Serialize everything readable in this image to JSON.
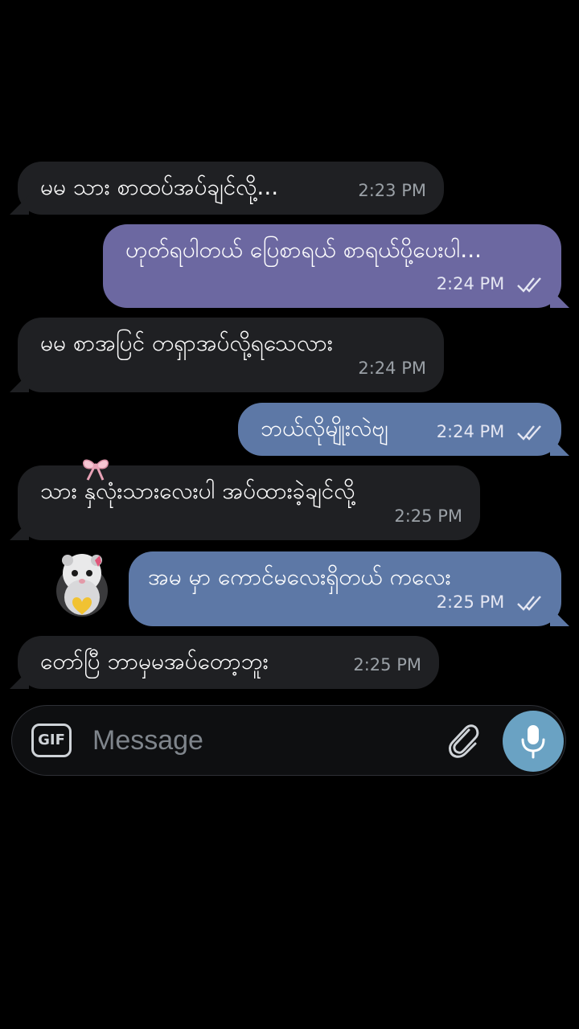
{
  "messages": [
    {
      "direction": "incoming",
      "text": "မမ သား စာထပ်အပ်ချင်လို့...",
      "time": "2:23 PM"
    },
    {
      "direction": "outgoing",
      "text": "ဟုတ်ရပါတယ် ပြေစာရယ် စာရယ်ပို့ပေးပါ...",
      "time": "2:24 PM",
      "read": true
    },
    {
      "direction": "incoming",
      "text": "မမ စာအပြင် တရှာအပ်လို့ရသေလား",
      "time": "2:24 PM"
    },
    {
      "direction": "outgoing",
      "text": "ဘယ်လိုမျိုးလဲဗျ",
      "time": "2:24 PM",
      "read": true
    },
    {
      "direction": "incoming",
      "text": "သား နှလုံးသားလေးပါ အပ်ထားခဲ့ချင်လို့",
      "time": "2:25 PM"
    },
    {
      "direction": "outgoing",
      "text": "အမ မှာ ကောင်မလေးရှိတယ် ကလေး",
      "time": "2:25 PM",
      "read": true
    },
    {
      "direction": "incoming",
      "text": "တော်ပြီ ဘာမှမအပ်တော့ဘူး",
      "time": "2:25 PM"
    }
  ],
  "composer": {
    "gif_label": "GIF",
    "placeholder": "Message"
  },
  "icons": {
    "attach": "paperclip-icon",
    "mic": "microphone-icon",
    "read_receipt": "double-check-icon",
    "bow_sticker": "ribbon-bow-icon",
    "avatar_sticker": "hamster-heart-sticker"
  },
  "colors": {
    "background": "#000000",
    "incoming_bubble": "#1f2023",
    "outgoing_bubble_purple": "#6c68a1",
    "outgoing_bubble_blue": "#5d78a6",
    "mic_button": "#6aa2c3"
  }
}
